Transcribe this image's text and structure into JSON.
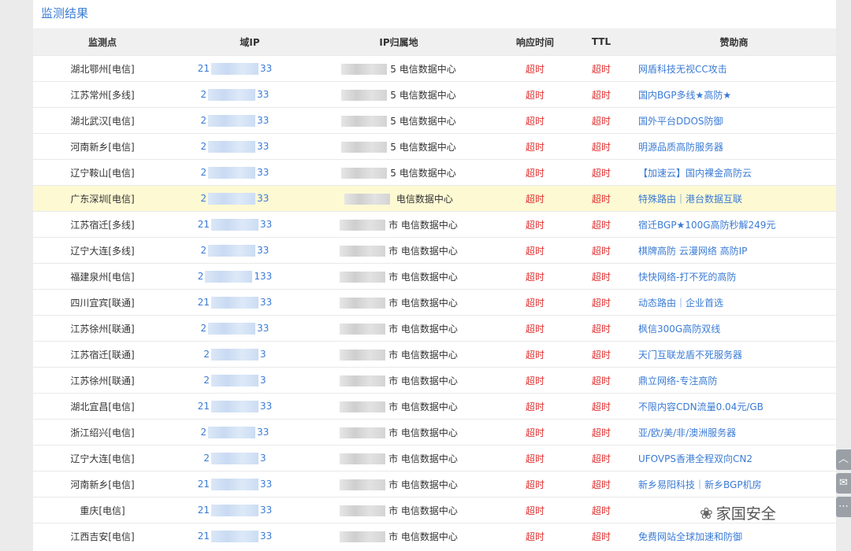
{
  "title": "监测结果",
  "headers": {
    "node": "监测点",
    "ip_prefix": "",
    "ip_suffix": "域IP",
    "location": "IP归属地",
    "response_time": "响应时间",
    "ttl": "TTL",
    "sponsor": "赞助商"
  },
  "rows": [
    {
      "node": "湖北鄂州[电信]",
      "ip_pre": "21",
      "ip_suf": "33",
      "loc": "电信数据中心",
      "loc_pre": "5",
      "time": "超时",
      "ttl": "超时",
      "sponsor": "网盾科技无视CC攻击"
    },
    {
      "node": "江苏常州[多线]",
      "ip_pre": "2",
      "ip_suf": "33",
      "loc": "电信数据中心",
      "loc_pre": "5",
      "time": "超时",
      "ttl": "超时",
      "sponsor": "国内BGP多线★高防★"
    },
    {
      "node": "湖北武汉[电信]",
      "ip_pre": "2",
      "ip_suf": "33",
      "loc": "电信数据中心",
      "loc_pre": "5",
      "time": "超时",
      "ttl": "超时",
      "sponsor": "国外平台DDOS防御"
    },
    {
      "node": "河南新乡[电信]",
      "ip_pre": "2",
      "ip_suf": "33",
      "loc": "电信数据中心",
      "loc_pre": "5",
      "time": "超时",
      "ttl": "超时",
      "sponsor": "明源品质高防服务器"
    },
    {
      "node": "辽宁鞍山[电信]",
      "ip_pre": "2",
      "ip_suf": "33",
      "loc": "电信数据中心",
      "loc_pre": "5",
      "time": "超时",
      "ttl": "超时",
      "sponsor": "【加速云】国内裸金高防云"
    },
    {
      "node": "广东深圳[电信]",
      "ip_pre": "2",
      "ip_suf": "33",
      "loc": "电信数据中心",
      "loc_pre": "",
      "time": "超时",
      "ttl": "超时",
      "sponsor": "特殊路由｜港台数据互联",
      "hl": true
    },
    {
      "node": "江苏宿迁[多线]",
      "ip_pre": "21",
      "ip_suf": "33",
      "loc": "电信数据中心",
      "loc_pre": "市",
      "time": "超时",
      "ttl": "超时",
      "sponsor": "宿迁BGP★100G高防秒解249元"
    },
    {
      "node": "辽宁大连[多线]",
      "ip_pre": "2",
      "ip_suf": "33",
      "loc": "电信数据中心",
      "loc_pre": "市",
      "time": "超时",
      "ttl": "超时",
      "sponsor": "棋牌高防 云漫网络 高防IP"
    },
    {
      "node": "福建泉州[电信]",
      "ip_pre": "2",
      "ip_suf": "133",
      "loc": "电信数据中心",
      "loc_pre": "市",
      "time": "超时",
      "ttl": "超时",
      "sponsor": "快快网络-打不死的高防"
    },
    {
      "node": "四川宜宾[联通]",
      "ip_pre": "21",
      "ip_suf": "33",
      "loc": "电信数据中心",
      "loc_pre": "市",
      "time": "超时",
      "ttl": "超时",
      "sponsor": "动态路由｜企业首选"
    },
    {
      "node": "江苏徐州[联通]",
      "ip_pre": "2",
      "ip_suf": "33",
      "loc": "电信数据中心",
      "loc_pre": "市",
      "time": "超时",
      "ttl": "超时",
      "sponsor": "枫信300G高防双线"
    },
    {
      "node": "江苏宿迁[联通]",
      "ip_pre": "2",
      "ip_suf": "3",
      "loc": "电信数据中心",
      "loc_pre": "市",
      "time": "超时",
      "ttl": "超时",
      "sponsor": "天门互联龙盾不死服务器"
    },
    {
      "node": "江苏徐州[联通]",
      "ip_pre": "2",
      "ip_suf": "3",
      "loc": "电信数据中心",
      "loc_pre": "市",
      "time": "超时",
      "ttl": "超时",
      "sponsor": "鼎立网络-专注高防"
    },
    {
      "node": "湖北宜昌[电信]",
      "ip_pre": "21",
      "ip_suf": "33",
      "loc": "电信数据中心",
      "loc_pre": "市",
      "time": "超时",
      "ttl": "超时",
      "sponsor": "不限内容CDN流量0.04元/GB"
    },
    {
      "node": "浙江绍兴[电信]",
      "ip_pre": "2",
      "ip_suf": "33",
      "loc": "电信数据中心",
      "loc_pre": "市",
      "time": "超时",
      "ttl": "超时",
      "sponsor": "亚/欧/美/非/澳洲服务器"
    },
    {
      "node": "辽宁大连[电信]",
      "ip_pre": "2",
      "ip_suf": "3",
      "loc": "电信数据中心",
      "loc_pre": "市",
      "time": "超时",
      "ttl": "超时",
      "sponsor": "UFOVPS香港全程双向CN2"
    },
    {
      "node": "河南新乡[电信]",
      "ip_pre": "21",
      "ip_suf": "33",
      "loc": "电信数据中心",
      "loc_pre": "市",
      "time": "超时",
      "ttl": "超时",
      "sponsor": "新乡易阳科技｜新乡BGP机房"
    },
    {
      "node": "重庆[电信]",
      "ip_pre": "21",
      "ip_suf": "33",
      "loc": "电信数据中心",
      "loc_pre": "市",
      "time": "超时",
      "ttl": "超时",
      "sponsor": ""
    },
    {
      "node": "江西吉安[电信]",
      "ip_pre": "21",
      "ip_suf": "33",
      "loc": "电信数据中心",
      "loc_pre": "市",
      "time": "超时",
      "ttl": "超时",
      "sponsor": "免费网站全球加速和防御"
    }
  ],
  "side_buttons": {
    "top_icon": "chevron-up-icon",
    "top_glyph": "︿",
    "msg_icon": "message-icon",
    "msg_glyph": "✉",
    "more_icon": "more-icon",
    "more_glyph": "⋯"
  },
  "watermark": {
    "icon": "wechat-icon",
    "glyph": "❀",
    "text": "家国安全"
  }
}
